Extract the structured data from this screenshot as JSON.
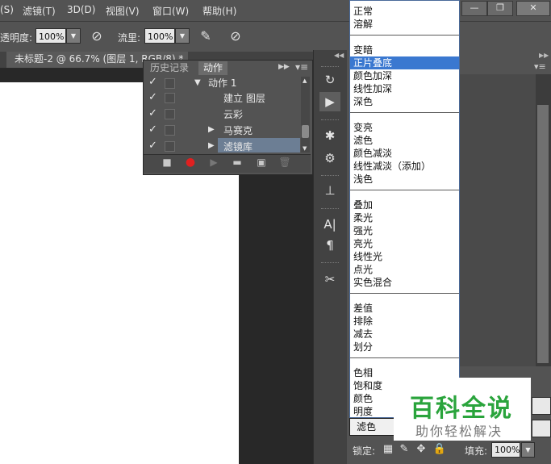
{
  "menubar": {
    "items": [
      "(S)",
      "滤镜(T)",
      "3D(D)",
      "视图(V)",
      "窗口(W)",
      "帮助(H)"
    ]
  },
  "window_controls": {
    "minimize": "—",
    "restore": "❐",
    "close": "✕"
  },
  "options": {
    "opacity_label": "透明度:",
    "opacity_value": "100%",
    "flow_label": "流里:",
    "flow_value": "100%"
  },
  "document_tab": {
    "title": "未标题-2 @ 66.7% (图层 1, RGB/8) *"
  },
  "actions_panel": {
    "tabs": [
      "历史记录",
      "动作"
    ],
    "active_tab": "动作",
    "rows": [
      {
        "label": "动作 1",
        "checked": true,
        "expanded": true
      },
      {
        "label": "建立 图层",
        "checked": true
      },
      {
        "label": "云彩",
        "checked": true
      },
      {
        "label": "马赛克",
        "checked": true
      },
      {
        "label": "滤镜库",
        "checked": true,
        "selected": true
      }
    ]
  },
  "blend_modes": {
    "groups": [
      [
        "正常",
        "溶解"
      ],
      [
        "变暗",
        "正片叠底",
        "颜色加深",
        "线性加深",
        "深色"
      ],
      [
        "变亮",
        "滤色",
        "颜色减淡",
        "线性减淡（添加）",
        "浅色"
      ],
      [
        "叠加",
        "柔光",
        "强光",
        "亮光",
        "线性光",
        "点光",
        "实色混合"
      ],
      [
        "差值",
        "排除",
        "减去",
        "划分"
      ],
      [
        "色相",
        "饱和度",
        "颜色",
        "明度"
      ]
    ],
    "highlighted": "正片叠底",
    "current_value": "滤色"
  },
  "layers_panel": {
    "lock_label": "锁定:",
    "fill_label": "填充:",
    "fill_value": "100%"
  },
  "watermark": {
    "title": "百科全说",
    "subtitle": "助你轻松解决"
  },
  "colors": {
    "ui_background": "#535353",
    "selection": "#3a78d0",
    "watermark_green": "#2aa43c",
    "record_red": "#e02020"
  }
}
